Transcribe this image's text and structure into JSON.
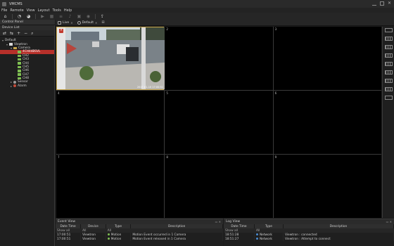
{
  "window": {
    "title": "VMCMS"
  },
  "menu": [
    "File",
    "Remote",
    "View",
    "Layout",
    "Tools",
    "Help"
  ],
  "toolbar": {
    "icons": [
      "home-icon",
      "wifi-icon",
      "signal-icon",
      "playback-icon",
      "grid-icon",
      "list-icon",
      "audio-icon",
      "device-icon",
      "alarm-icon",
      "settings-icon",
      "upload-icon"
    ]
  },
  "control_panel": {
    "title": "Control Panel",
    "device_list_title": "Device List"
  },
  "tree": {
    "root": "Default",
    "site": "Viewtron",
    "camera_group": "Camera",
    "channels": [
      "4CH44BSVL",
      "CH2",
      "CH3",
      "CH4",
      "CH5",
      "CH6",
      "CH7",
      "CH8"
    ],
    "sensor": "Sensor",
    "alarm": "Alarm"
  },
  "tabs": [
    {
      "label": "Live"
    },
    {
      "label": "Default"
    }
  ],
  "grid": {
    "cells": [
      "1",
      "2",
      "3",
      "4",
      "5",
      "6",
      "7",
      "8",
      "9"
    ],
    "camera_timestamp": "2017-01-10 17:00:51"
  },
  "event_view": {
    "title": "Event View",
    "columns": [
      "Date Time",
      "Device",
      "Type",
      "Description"
    ],
    "filter": [
      "Show all",
      "All",
      "All",
      ""
    ],
    "rows": [
      {
        "time": "17:00:51",
        "device": "Viewtron",
        "type": "Motion",
        "description": "Motion Event occurred in 1 Camera"
      },
      {
        "time": "17:00:51",
        "device": "Viewtron",
        "type": "Motion",
        "description": "Motion Event released in 1 Camera"
      }
    ]
  },
  "log_view": {
    "title": "Log View",
    "columns": [
      "Date Time",
      "Type",
      "Description"
    ],
    "filter": [
      "Show all",
      "All",
      ""
    ],
    "rows": [
      {
        "time": "18:51:28",
        "type": "Network",
        "description": "Viewtron : connected"
      },
      {
        "time": "18:51:27",
        "type": "Network",
        "description": "Viewtron : Attempt to connect"
      }
    ]
  },
  "colors": {
    "accent_red": "#c23b2f",
    "active_border": "#c9a648",
    "motion": "#7fbf52",
    "network": "#4a8bd0"
  }
}
